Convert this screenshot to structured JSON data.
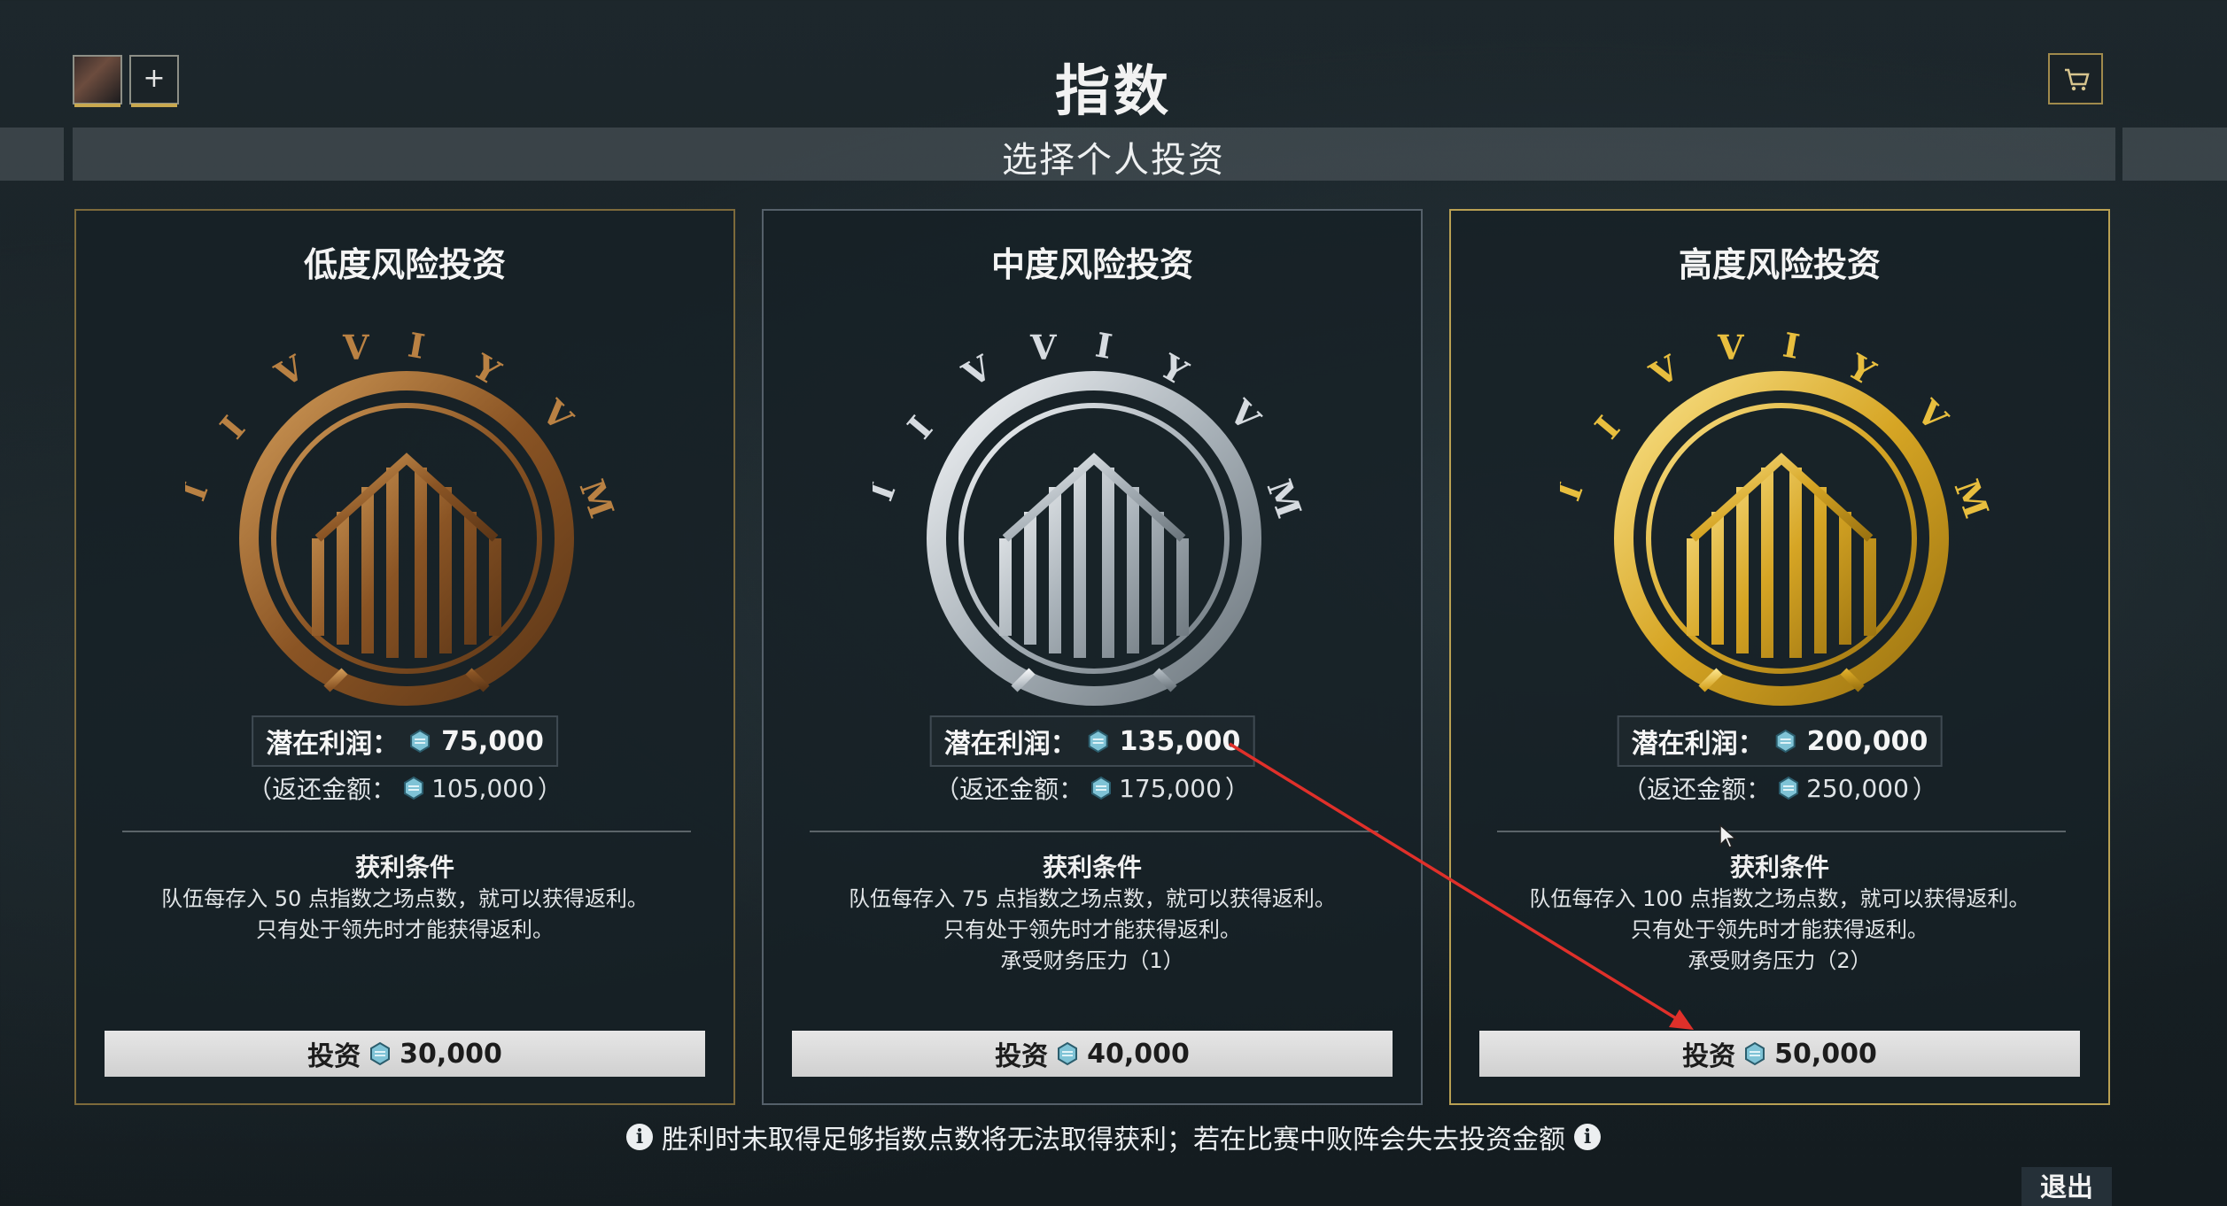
{
  "header": {
    "title": "指数",
    "subtitle": "选择个人投资",
    "add_label": "+"
  },
  "cards": [
    {
      "title": "低度风险投资",
      "profit_label": "潜在利润：",
      "profit_value": "75,000",
      "refund_open": "（返还金额：",
      "refund_value": "105,000",
      "refund_close": "）",
      "cond_title": "获利条件",
      "cond_lines": [
        "队伍每存入 50 点指数之场点数，就可以获得返利。",
        "只有处于领先时才能获得返利。"
      ],
      "invest_label": "投资",
      "invest_value": "30,000",
      "tier_color": "#a8692a"
    },
    {
      "title": "中度风险投资",
      "profit_label": "潜在利润：",
      "profit_value": "135,000",
      "refund_open": "（返还金额：",
      "refund_value": "175,000",
      "refund_close": "）",
      "cond_title": "获利条件",
      "cond_lines": [
        "队伍每存入 75 点指数之场点数，就可以获得返利。",
        "只有处于领先时才能获得返利。",
        "承受财务压力（1）"
      ],
      "invest_label": "投资",
      "invest_value": "40,000",
      "tier_color": "#c9d0d6"
    },
    {
      "title": "高度风险投资",
      "profit_label": "潜在利润：",
      "profit_value": "200,000",
      "refund_open": "（返还金额：",
      "refund_value": "250,000",
      "refund_close": "）",
      "cond_title": "获利条件",
      "cond_lines": [
        "队伍每存入 100 点指数之场点数，就可以获得返利。",
        "只有处于领先时才能获得返利。",
        "承受财务压力（2）"
      ],
      "invest_label": "投资",
      "invest_value": "50,000",
      "tier_color": "#e0b22e"
    }
  ],
  "footer": {
    "note": "胜利时未取得足够指数点数将无法取得获利；若在比赛中败阵会失去投资金额",
    "exit_label": "退出"
  },
  "colors": {
    "bronze": "#a8692a",
    "silver": "#c9d0d6",
    "gold": "#e0b22e",
    "annotation_arrow": "#e0302a"
  }
}
